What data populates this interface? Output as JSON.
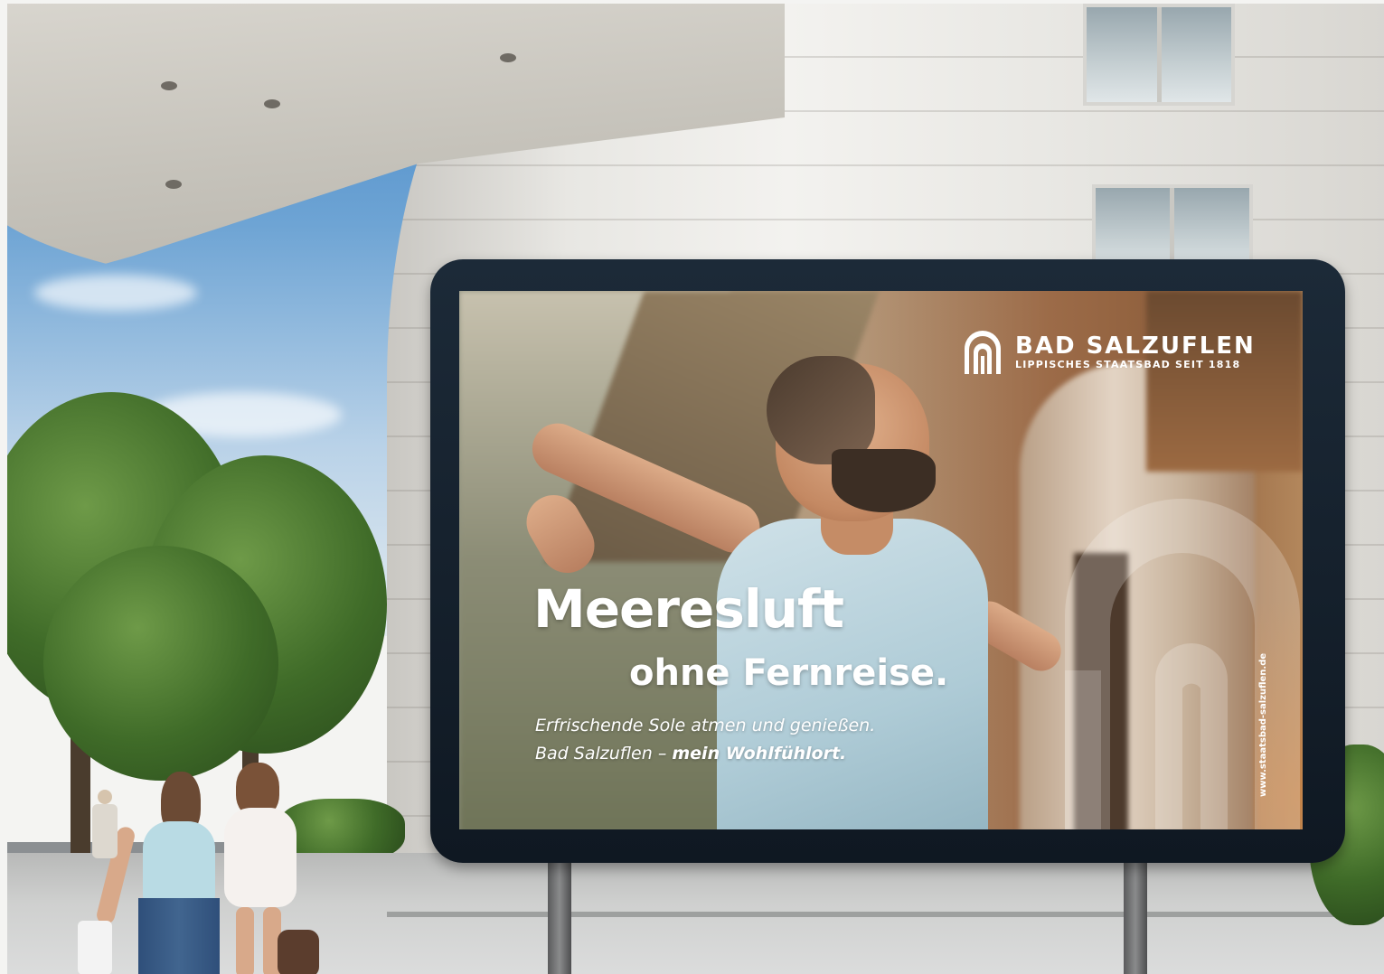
{
  "billboard": {
    "brand": {
      "title": "BAD SALZUFLEN",
      "subtitle": "LIPPISCHES STAATSBAD SEIT 1818",
      "icon": "arch-columns-logo-icon"
    },
    "headline_line1": "Meeresluft",
    "headline_line2": "ohne Fernreise.",
    "subline_line1": "Erfrischende Sole atmen und genießen.",
    "subline_line2_prefix": "Bad Salzuflen – ",
    "subline_line2_bold": "mein Wohlfühlort.",
    "url": "www.staatsbad-salzuflen.de"
  },
  "colors": {
    "frame": "#0f1822",
    "text": "#ffffff",
    "sky": "#4f8fcc",
    "foliage": "#3f6b28"
  }
}
